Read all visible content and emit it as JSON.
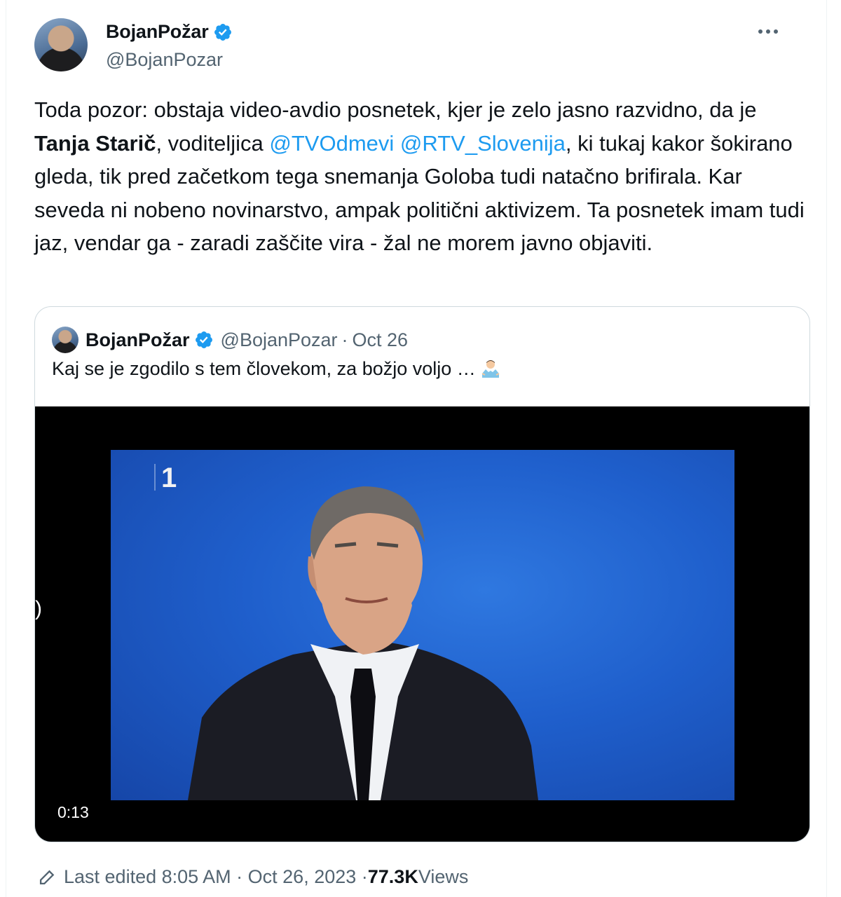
{
  "author": {
    "display_name": "BojanPožar",
    "handle": "@BojanPozar"
  },
  "tweet": {
    "text_1": "Toda pozor: obstaja video-avdio posnetek, kjer je zelo jasno razvidno, da je ",
    "bold_name": "Tanja Starič",
    "text_2": ", voditeljica ",
    "mention_1": "@TVOdmevi",
    "text_3": " ",
    "mention_2": "@RTV_Slovenija",
    "text_4": ", ki tukaj kakor šokirano gleda, tik pred začetkom tega snemanja Goloba tudi natačno brifirala. Kar seveda ni nobeno novinarstvo, ampak politični aktivizem. Ta posnetek imam tudi jaz, vendar ga - zaradi zaščite vira - žal ne morem javno objaviti."
  },
  "quoted_tweet": {
    "display_name": "BojanPožar",
    "handle": "@BojanPozar",
    "separator": "·",
    "date": "Oct 26",
    "text": "Kaj se je zgodilo s tem človekom, za božjo voljo …",
    "emoji": "man-shrugging-icon",
    "video": {
      "channel_logo": "1",
      "side_glyph": ")",
      "duration": "0:13"
    }
  },
  "footer": {
    "edited_label": "Last edited 8:05 AM · Oct 26, 2023 · ",
    "views_count": "77.3K",
    "views_label": " Views"
  },
  "colors": {
    "link": "#1d9bf0",
    "muted": "#536471",
    "verified": "#1d9bf0",
    "video_bg": "#1f5fcc"
  }
}
